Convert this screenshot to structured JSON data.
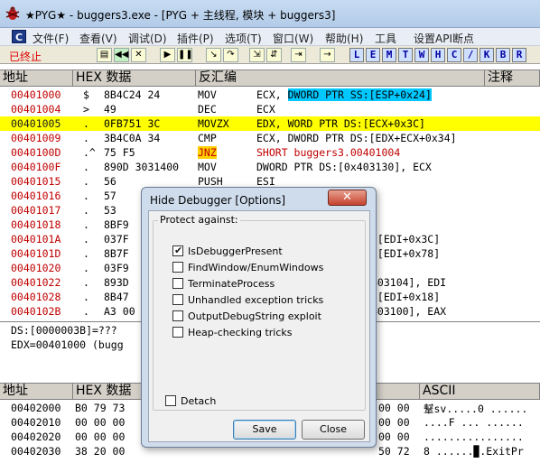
{
  "window": {
    "title": "★PYG★ - buggers3.exe - [PYG + 主线程, 模块 + buggers3]"
  },
  "menu": {
    "cpu_icon": "C",
    "items": [
      "文件(F)",
      "查看(V)",
      "调试(D)",
      "插件(P)",
      "选项(T)",
      "窗口(W)",
      "帮助(H)",
      "工具",
      "设置API断点"
    ]
  },
  "toolbar": {
    "status": "已终止",
    "buttons": [
      "open-icon",
      "rewind-icon",
      "close-icon",
      "run-icon",
      "pause-icon",
      "step-into-icon",
      "step-over-icon",
      "trace-into-icon",
      "trace-over-icon",
      "execute-till-return-icon",
      "go-to-icon"
    ],
    "letters": [
      "L",
      "E",
      "M",
      "T",
      "W",
      "H",
      "C",
      "/",
      "K",
      "B",
      "R"
    ]
  },
  "cpu": {
    "headers": {
      "address": "地址",
      "hex": "HEX 数据",
      "disasm": "反汇编",
      "comment": "注释"
    },
    "rows": [
      {
        "addr": "00401000",
        "marker": "$",
        "hex": "8B4C24 24",
        "op": "MOV",
        "args": "ECX, ",
        "hl": "DWORD PTR SS:[ESP+0x24]",
        "tail": "",
        "style": "red"
      },
      {
        "addr": "00401004",
        "marker": ">",
        "hex": "49",
        "op": "DEC",
        "args": "ECX",
        "hl": "",
        "tail": "",
        "style": "red"
      },
      {
        "addr": "00401005",
        "marker": ".",
        "hex": "0FB751 3C",
        "op": "MOVZX",
        "args": "EDX, WORD PTR DS:[ECX+0x3C]",
        "hl": "",
        "tail": "",
        "style": "sel"
      },
      {
        "addr": "00401009",
        "marker": ".",
        "hex": "3B4C0A 34",
        "op": "CMP",
        "args": "ECX, DWORD PTR DS:[EDX+ECX+0x34]",
        "hl": "",
        "tail": "",
        "style": "red"
      },
      {
        "addr": "0040100D",
        "marker": ".^",
        "hex": "75 F5",
        "op": "JNZ",
        "args": "SHORT buggers3.00401004",
        "hl": "",
        "tail": "",
        "style": "jnz"
      },
      {
        "addr": "0040100F",
        "marker": ".",
        "hex": "890D 3031400",
        "op": "MOV",
        "args": "DWORD PTR DS:[0x403130], ECX",
        "hl": "",
        "tail": "",
        "style": "red"
      },
      {
        "addr": "00401015",
        "marker": ".",
        "hex": "56",
        "op": "PUSH",
        "args": "ESI",
        "hl": "",
        "tail": "",
        "style": "red"
      },
      {
        "addr": "00401016",
        "marker": ".",
        "hex": "57",
        "op": "",
        "args": "",
        "hl": "",
        "tail": "",
        "style": "red"
      },
      {
        "addr": "00401017",
        "marker": ".",
        "hex": "53",
        "op": "",
        "args": "",
        "hl": "",
        "tail": "",
        "style": "red"
      },
      {
        "addr": "00401018",
        "marker": ".",
        "hex": "8BF9",
        "op": "",
        "args": "",
        "hl": "",
        "tail": "",
        "style": "red"
      },
      {
        "addr": "0040101A",
        "marker": ".",
        "hex": "037F",
        "op": "",
        "args": "",
        "hl": "",
        "tail": ":[EDI+0x3C]",
        "style": "red"
      },
      {
        "addr": "0040101D",
        "marker": ".",
        "hex": "8B7F",
        "op": "",
        "args": "",
        "hl": "",
        "tail": ":[EDI+0x78]",
        "style": "red"
      },
      {
        "addr": "00401020",
        "marker": ".",
        "hex": "03F9",
        "op": "",
        "args": "",
        "hl": "",
        "tail": "",
        "style": "red"
      },
      {
        "addr": "00401022",
        "marker": ".",
        "hex": "893D",
        "op": "",
        "args": "",
        "hl": "",
        "tail": "403104], EDI",
        "style": "red"
      },
      {
        "addr": "00401028",
        "marker": ".",
        "hex": "8B47",
        "op": "",
        "args": "",
        "hl": "",
        "tail": ":[EDI+0x18]",
        "style": "red"
      },
      {
        "addr": "0040102B",
        "marker": ".",
        "hex": "A3 00",
        "op": "",
        "args": "",
        "hl": "",
        "tail": "403100], EAX",
        "style": "red"
      }
    ]
  },
  "info": {
    "line1": "DS:[0000003B]=???",
    "line2": "EDX=00401000 (bugg"
  },
  "dump": {
    "headers": {
      "address": "地址",
      "hex": "HEX 数据",
      "ascii": "ASCII"
    },
    "rows": [
      {
        "addr": "00402000",
        "hex": "B0 79 73",
        "tailhex": "00 00",
        "ascii": "鞤sv.....0 ......"
      },
      {
        "addr": "00402010",
        "hex": "00 00 00",
        "tailhex": "00 00",
        "ascii": "....F ... ......"
      },
      {
        "addr": "00402020",
        "hex": "00 00 00",
        "tailhex": "00 00",
        "ascii": "................"
      },
      {
        "addr": "00402030",
        "hex": "38 20 00",
        "tailhex": "50 72",
        "ascii": "8 ......▉.ExitPr"
      }
    ]
  },
  "dialog": {
    "title": "Hide Debugger [Options]",
    "group_label": "Protect against:",
    "options": [
      {
        "label": "IsDebuggerPresent",
        "checked": true
      },
      {
        "label": "FindWindow/EnumWindows",
        "checked": false
      },
      {
        "label": "TerminateProcess",
        "checked": false
      },
      {
        "label": "Unhandled exception tricks",
        "checked": false
      },
      {
        "label": "OutputDebugString exploit",
        "checked": false
      },
      {
        "label": "Heap-checking tricks",
        "checked": false
      }
    ],
    "detach_label": "Detach",
    "detach_checked": false,
    "save_label": "Save",
    "close_label": "Close"
  },
  "colors": {
    "selected_row": "#ffff00",
    "address_red": "#c00000",
    "operand_highlight": "#00c8ff",
    "jump_highlight": "#ffd000"
  }
}
